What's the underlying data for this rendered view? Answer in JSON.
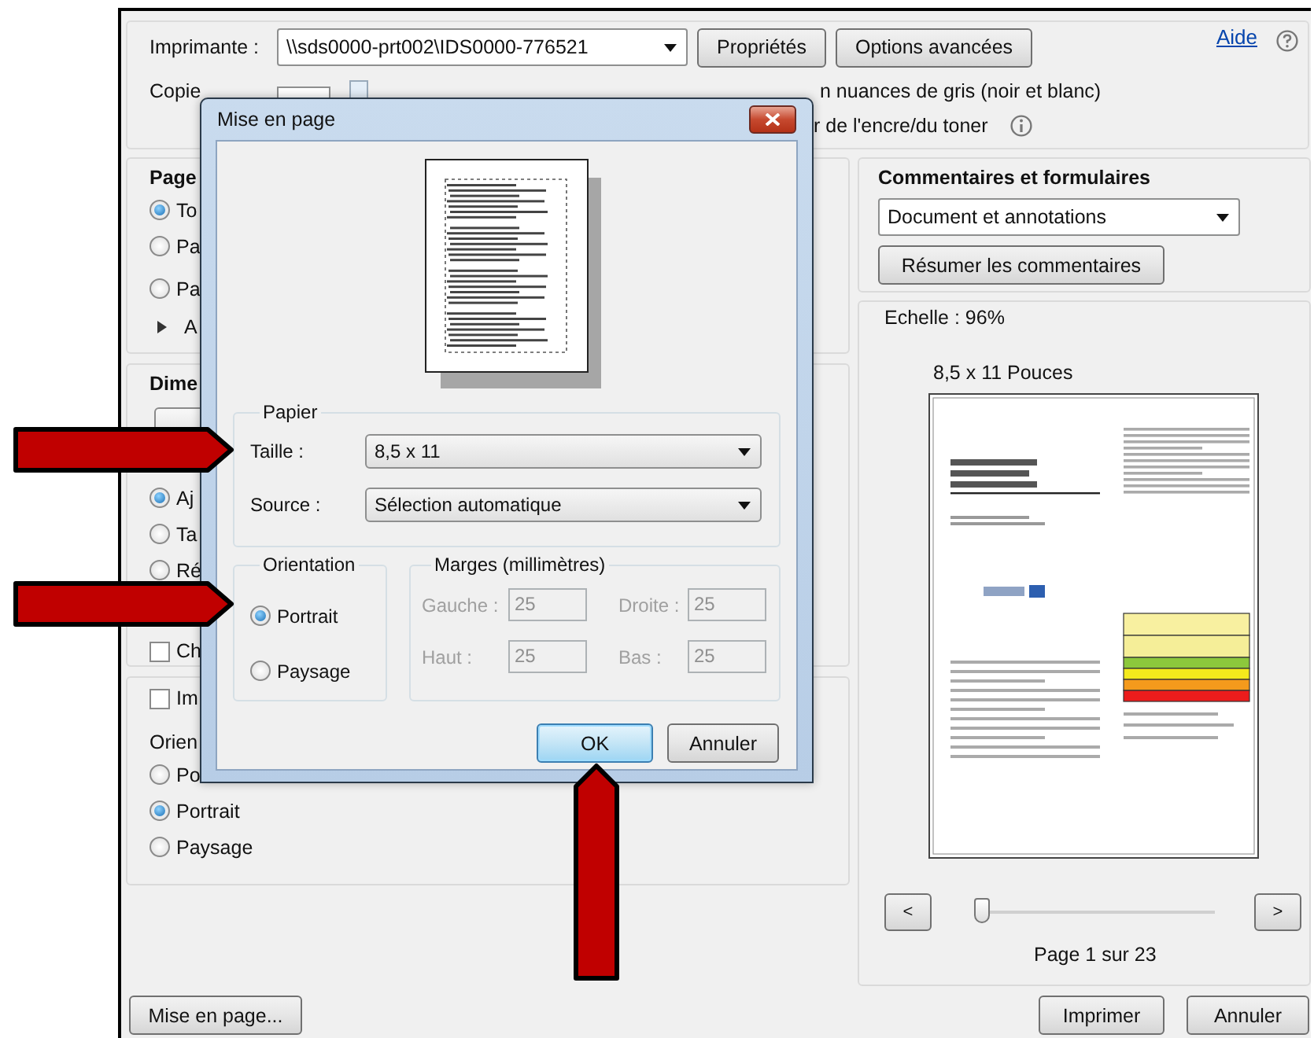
{
  "print_dialog": {
    "printer_label": "Imprimante :",
    "printer": "\\\\sds0000-prt002\\IDS0000-776521",
    "properties_button": "Propriétés",
    "advanced_button": "Options avancées",
    "help_link": "Aide",
    "copies_label": "Copie",
    "grayscale": "n nuances de gris (noir et blanc)",
    "ink_saver": "r de l'encre/du toner",
    "pages": {
      "title": "Page",
      "options": [
        {
          "label": "To",
          "selected": true
        },
        {
          "label": "Pa",
          "selected": false
        },
        {
          "label": "Pa",
          "selected": false
        }
      ],
      "more": "A"
    },
    "sizing": {
      "title": "Dime",
      "options": [
        {
          "label": "Aj",
          "selected": true
        },
        {
          "label": "Ta",
          "selected": false
        },
        {
          "label": "Ré",
          "selected": false
        }
      ],
      "checkbox": {
        "label": "Ch",
        "checked": false
      }
    },
    "orientation_section": {
      "checkbox": {
        "label": "Im",
        "checked": false
      },
      "title": "Orien",
      "options": [
        {
          "label": "Po",
          "selected": false
        },
        {
          "label": "Portrait",
          "selected": true
        },
        {
          "label": "Paysage",
          "selected": false
        }
      ]
    },
    "comments": {
      "title": "Commentaires et formulaires",
      "select": "Document et annotations",
      "summarize_button": "Résumer les commentaires"
    },
    "preview": {
      "scale": "Echelle :  96%",
      "page_size": "8,5 x 11 Pouces",
      "prev": "<",
      "next": ">",
      "slider": {
        "level": 0
      },
      "page_info": "Page 1 sur 23"
    },
    "page_setup_button": "Mise en page...",
    "print_button": "Imprimer",
    "cancel_button": "Annuler"
  },
  "page_setup": {
    "title": "Mise en page",
    "paper": {
      "title": "Papier",
      "size_label": "Taille :",
      "size": "8,5 x 11",
      "source_label": "Source :",
      "source": "Sélection automatique"
    },
    "orientation": {
      "title": "Orientation",
      "options": [
        {
          "label": "Portrait",
          "selected": true
        },
        {
          "label": "Paysage",
          "selected": false
        }
      ]
    },
    "margins": {
      "title": "Marges (millimètres)",
      "disabled": true,
      "fields": [
        {
          "label": "Gauche :",
          "value": "25"
        },
        {
          "label": "Droite :",
          "value": "25"
        },
        {
          "label": "Haut :",
          "value": "25"
        },
        {
          "label": "Bas :",
          "value": "25"
        }
      ]
    },
    "ok_button": "OK",
    "cancel_button": "Annuler"
  },
  "annotations": [
    {
      "kind": "arrow_right"
    },
    {
      "kind": "arrow_right"
    },
    {
      "kind": "arrow_up"
    }
  ]
}
